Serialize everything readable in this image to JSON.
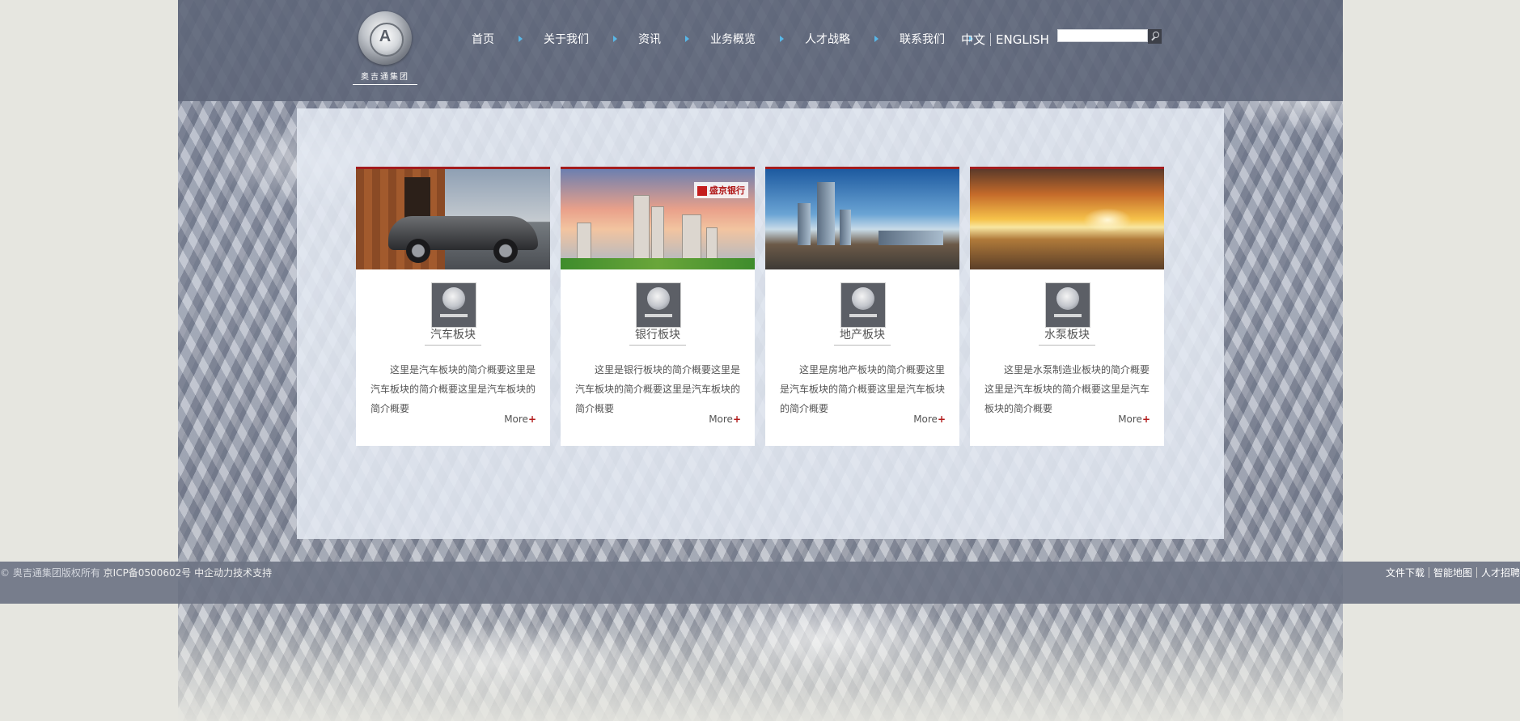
{
  "header": {
    "logo_text": "奥吉通集团",
    "logo_letter": "A",
    "nav": [
      {
        "label": "首页"
      },
      {
        "label": "关于我们"
      },
      {
        "label": "资讯"
      },
      {
        "label": "业务概览"
      },
      {
        "label": "人才战略"
      },
      {
        "label": "联系我们"
      }
    ],
    "lang_cn": "中文",
    "lang_en": "ENGLISH",
    "search": {
      "value": "",
      "placeholder": ""
    }
  },
  "colors": {
    "accent": "#a31b1d",
    "nav_arrow": "#58b7e8",
    "header_bg": "#5f677a"
  },
  "cards": [
    {
      "title": "汽车板块",
      "text": "这里是汽车板块的简介概要这里是汽车板块的简介概要这里是汽车板块的简介概要",
      "more": "More",
      "more_icon": "+"
    },
    {
      "title": "银行板块",
      "text": "这里是银行板块的简介概要这里是汽车板块的简介概要这里是汽车板块的简介概要",
      "more": "More",
      "more_icon": "+",
      "photo_badge": "盛京银行"
    },
    {
      "title": "地产板块",
      "text": "这里是房地产板块的简介概要这里是汽车板块的简介概要这里是汽车板块的简介概要",
      "more": "More",
      "more_icon": "+"
    },
    {
      "title": "水泵板块",
      "text": "这里是水泵制造业板块的简介概要这里是汽车板块的简介概要这里是汽车板块的简介概要",
      "more": "More",
      "more_icon": "+"
    }
  ],
  "footer": {
    "copyright": "© 奥吉通集团版权所有",
    "icp": "京ICP备0500602号 中企动力技术支持",
    "links": [
      {
        "label": "文件下载"
      },
      {
        "label": "智能地图"
      },
      {
        "label": "人才招聘"
      }
    ]
  }
}
